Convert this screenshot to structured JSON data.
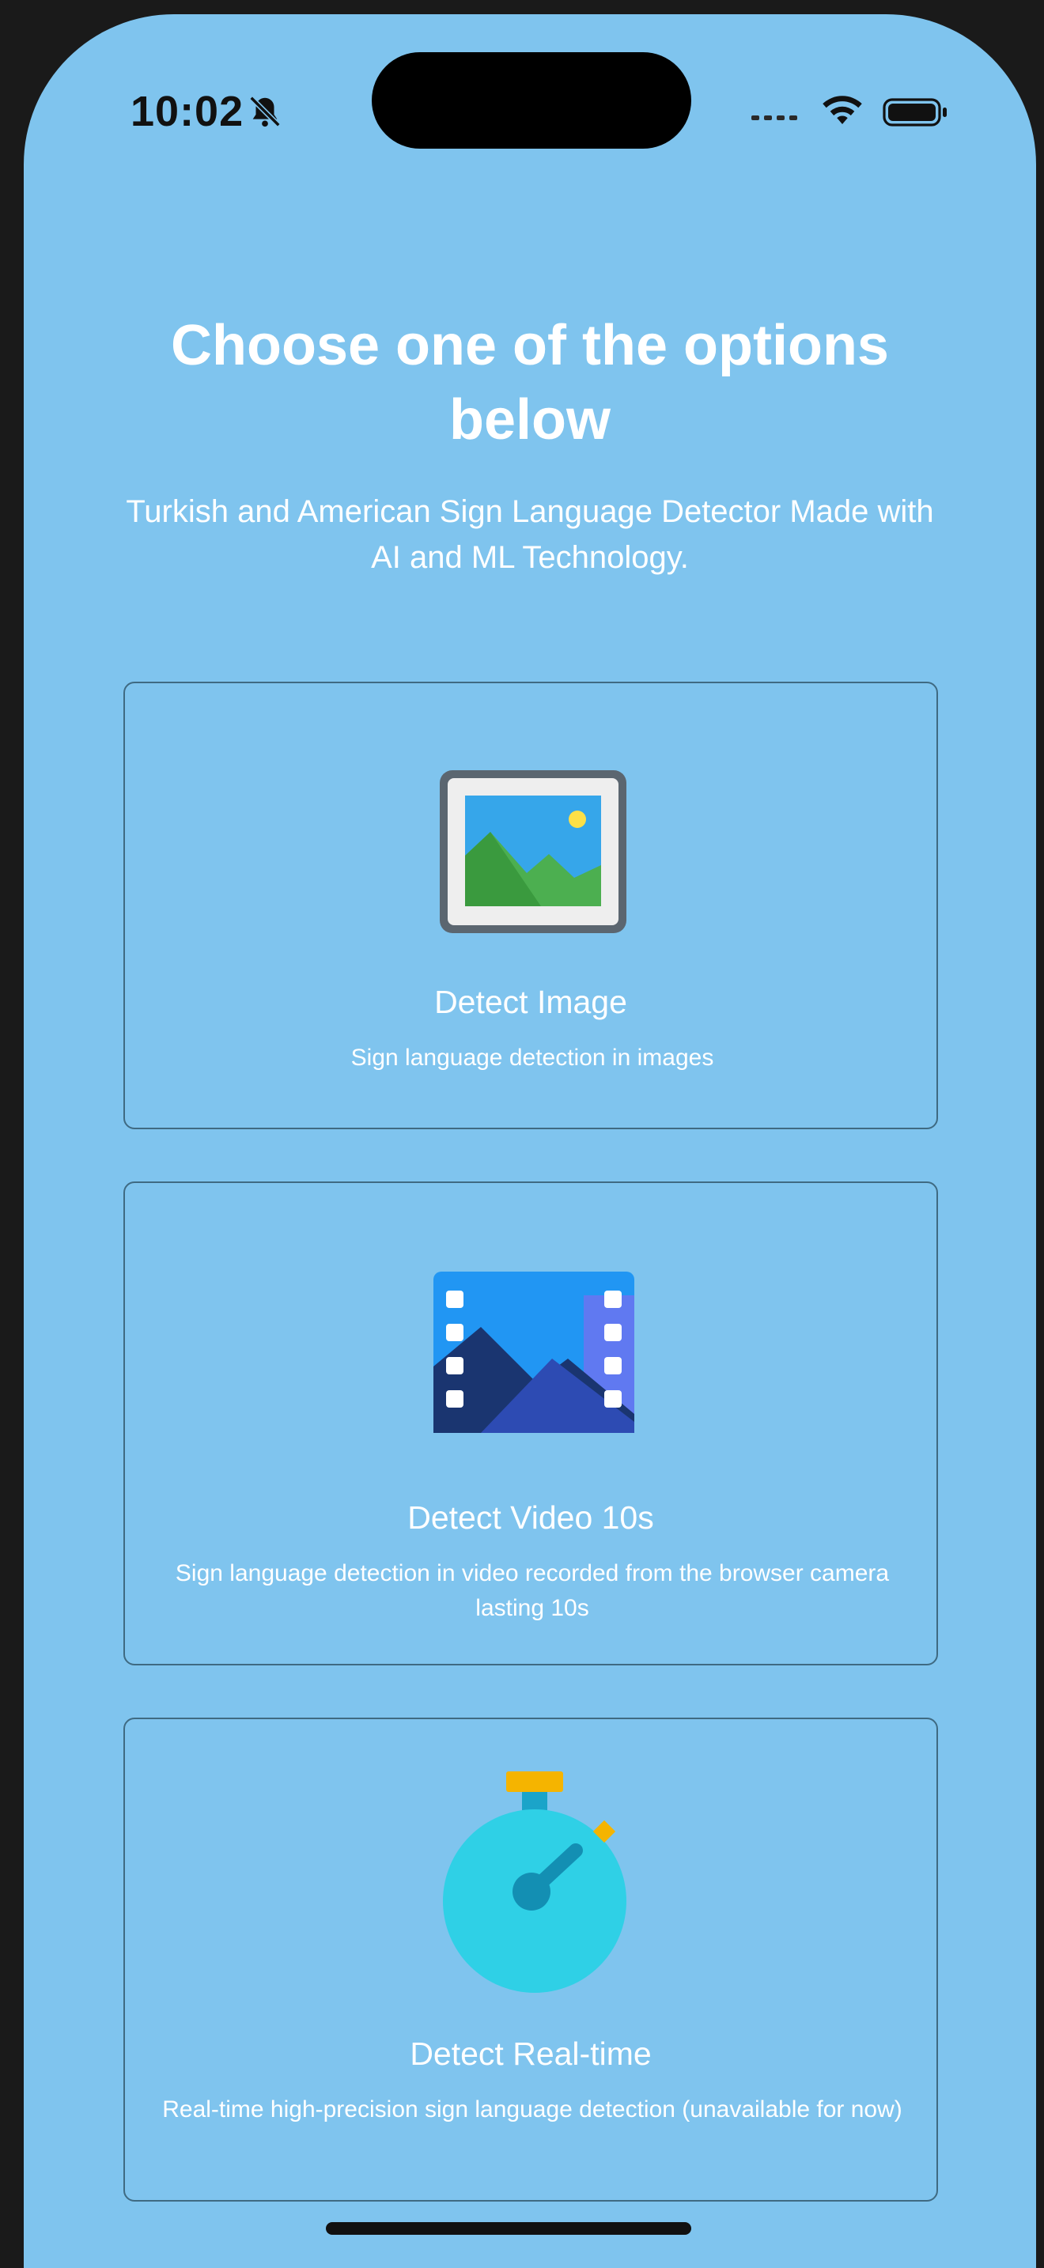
{
  "status_bar": {
    "time": "10:02",
    "icons": [
      "bell-slash-icon",
      "cellular-icon",
      "wifi-icon",
      "battery-icon"
    ]
  },
  "header": {
    "title": "Choose one of the options below",
    "subtitle": "Turkish and American Sign Language Detector Made with AI and ML Technology."
  },
  "options": [
    {
      "title": "Detect Image",
      "description": "Sign language detection in images",
      "icon": "picture-icon"
    },
    {
      "title": "Detect Video 10s",
      "description": "Sign language detection in video recorded from the browser camera lasting 10s",
      "icon": "video-film-icon"
    },
    {
      "title": "Detect Real-time",
      "description": "Real-time high-precision sign language detection (unavailable for now)",
      "icon": "stopwatch-icon"
    }
  ],
  "colors": {
    "background": "#7fc4ee",
    "text": "#ffffff",
    "card_border": "#3f6a82"
  }
}
